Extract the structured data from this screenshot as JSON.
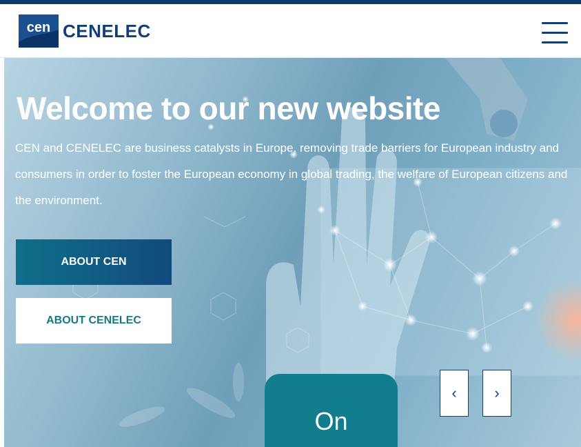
{
  "header": {
    "logo": {
      "mark_text": "cen",
      "wordmark": "CENELEC",
      "brand_color": "#123d75"
    },
    "menu_icon": "hamburger-menu-icon"
  },
  "hero": {
    "title": "Welcome to our new website",
    "description": "CEN and CENELEC are business catalysts in Europe, removing trade barriers for European industry and consumers in order to foster the European economy in global trading, the welfare of European citizens and the environment.",
    "buttons": {
      "about_cen": "ABOUT CEN",
      "about_cenelec": "ABOUT CENELEC"
    },
    "carousel": {
      "prev_label": "‹",
      "next_label": "›"
    },
    "floating_tab_label": "On"
  },
  "colors": {
    "navy": "#123d75",
    "teal": "#127e8d",
    "white": "#ffffff"
  }
}
